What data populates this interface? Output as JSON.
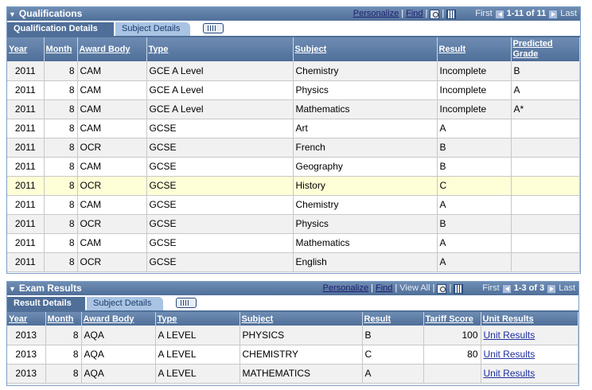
{
  "qualifications": {
    "title": "Qualifications",
    "nav": {
      "personalize": "Personalize",
      "find": "Find",
      "first": "First",
      "range": "1-11 of 11",
      "last": "Last"
    },
    "tabs": [
      "Qualification Details",
      "Subject Details"
    ],
    "columns": [
      "Year",
      "Month",
      "Award Body",
      "Type",
      "Subject",
      "Result",
      "Predicted Grade"
    ],
    "rows": [
      [
        "2011",
        "8",
        "CAM",
        "GCE A Level",
        "Chemistry",
        "Incomplete",
        "B"
      ],
      [
        "2011",
        "8",
        "CAM",
        "GCE A Level",
        "Physics",
        "Incomplete",
        "A"
      ],
      [
        "2011",
        "8",
        "CAM",
        "GCE A Level",
        "Mathematics",
        "Incomplete",
        "A*"
      ],
      [
        "2011",
        "8",
        "CAM",
        "GCSE",
        "Art",
        "A",
        ""
      ],
      [
        "2011",
        "8",
        "OCR",
        "GCSE",
        "French",
        "B",
        ""
      ],
      [
        "2011",
        "8",
        "CAM",
        "GCSE",
        "Geography",
        "B",
        ""
      ],
      [
        "2011",
        "8",
        "OCR",
        "GCSE",
        "History",
        "C",
        ""
      ],
      [
        "2011",
        "8",
        "CAM",
        "GCSE",
        "Chemistry",
        "A",
        ""
      ],
      [
        "2011",
        "8",
        "OCR",
        "GCSE",
        "Physics",
        "B",
        ""
      ],
      [
        "2011",
        "8",
        "CAM",
        "GCSE",
        "Mathematics",
        "A",
        ""
      ],
      [
        "2011",
        "8",
        "OCR",
        "GCSE",
        "English",
        "A",
        ""
      ]
    ],
    "highlighted_row": 6
  },
  "exam_results": {
    "title": "Exam Results",
    "nav": {
      "personalize": "Personalize",
      "find": "Find",
      "view_all": "View All",
      "first": "First",
      "range": "1-3 of 3",
      "last": "Last"
    },
    "tabs": [
      "Result Details",
      "Subject Details"
    ],
    "columns": [
      "Year",
      "Month",
      "Award Body",
      "Type",
      "Subject",
      "Result",
      "Tariff Score",
      "Unit Results"
    ],
    "rows": [
      [
        "2013",
        "8",
        "AQA",
        "A LEVEL",
        "PHYSICS",
        "B",
        "100",
        "Unit Results"
      ],
      [
        "2013",
        "8",
        "AQA",
        "A LEVEL",
        "CHEMISTRY",
        "C",
        "80",
        "Unit Results"
      ],
      [
        "2013",
        "8",
        "AQA",
        "A LEVEL",
        "MATHEMATICS",
        "A",
        "",
        "Unit Results"
      ]
    ]
  },
  "icons": {
    "collapse": "triangle-down-icon",
    "zoom": "zoom-icon",
    "download": "spreadsheet-icon",
    "first": "previous-arrow-icon",
    "last": "next-arrow-icon",
    "show_all_columns": "show-all-columns-icon"
  },
  "colors": {
    "header_blue": "#4f6f99",
    "row_odd": "#f1f1f1",
    "row_highlight": "#ffffd7",
    "link": "#1f2fa0"
  }
}
